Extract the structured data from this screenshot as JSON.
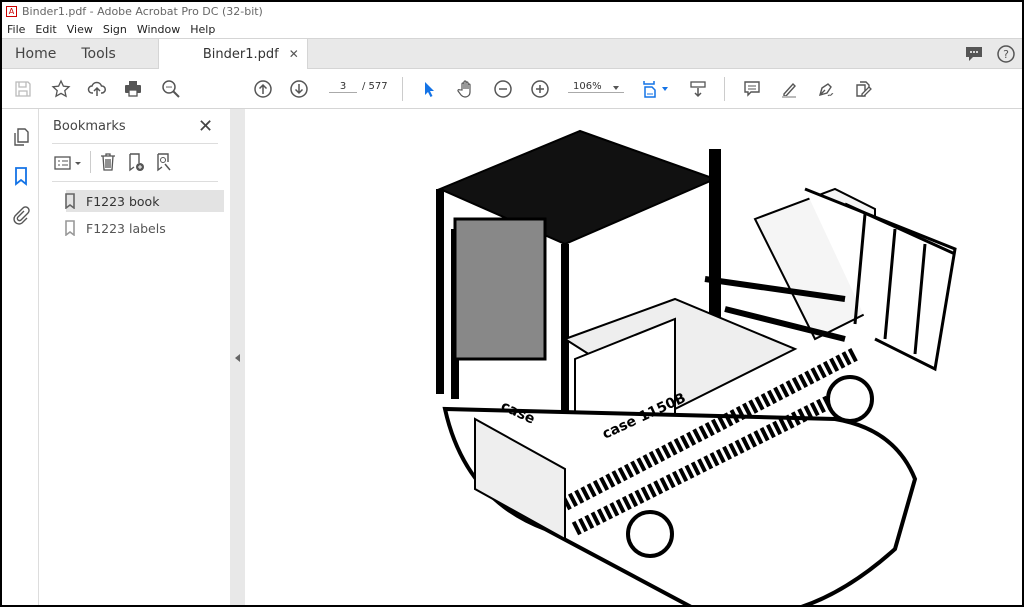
{
  "window": {
    "title": "Binder1.pdf - Adobe Acrobat Pro DC (32-bit)"
  },
  "menu": [
    "File",
    "Edit",
    "View",
    "Sign",
    "Window",
    "Help"
  ],
  "tabs": {
    "home": "Home",
    "tools": "Tools",
    "document": "Binder1.pdf"
  },
  "toolbar": {
    "page_current": "3",
    "page_total": "/ 577",
    "zoom": "106%"
  },
  "bookmarks": {
    "title": "Bookmarks",
    "items": [
      {
        "label": "F1223 book",
        "selected": true
      },
      {
        "label": "F1223 labels",
        "selected": false
      }
    ]
  },
  "colors": {
    "accent": "#1473e6"
  }
}
